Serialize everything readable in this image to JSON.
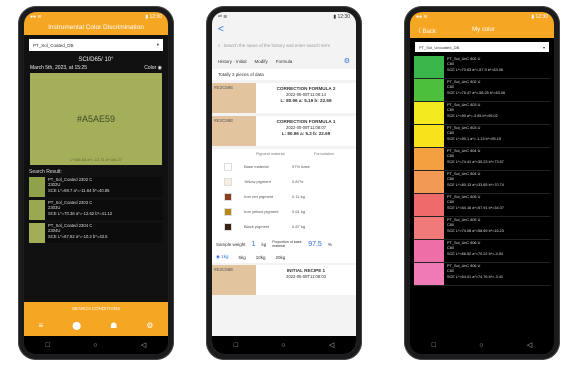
{
  "phone1": {
    "status_left": "●● ≋",
    "status_right": "▮ 12:30",
    "title": "Instrumental Color Discrimination",
    "select_value": "PT_Sol_Coated_DB",
    "condition": "SCI/D65/ 10°",
    "date": "March 5th, 2023, at 15:25",
    "color_label": "Color",
    "hex": "#A5AE59",
    "swatch_sub": "L*=68.53 a*=-12.71 b*=44.27",
    "search_label": "Search Result:",
    "results": [
      {
        "color": "#8fa24a",
        "line1": "PT_Sol_Coated 2302 C",
        "line2": "2302U",
        "line3": "SCE L*=69.7 a*=-11.64 b*=40.85"
      },
      {
        "color": "#9aa84f",
        "line1": "PT_Sol_Coated 2303 C",
        "line2": "2303U",
        "line3": "SCE L*=70.36 a*=-12.62 b*=41.12"
      },
      {
        "color": "#a3ad55",
        "line1": "PT_Sol_Coated 2304 C",
        "line2": "2304U",
        "line3": "SCE L*=67.82 a*=-10.2 b*=43.5"
      }
    ],
    "button": "SEARCH CONDITIONS",
    "tabs": [
      "≡",
      "⬤",
      "☗",
      "⚙"
    ],
    "nav": [
      "□",
      "○",
      "◁"
    ]
  },
  "phone2": {
    "status_left": "ᵃᵗˡ ≋",
    "status_right": "▮ 12:30",
    "back": "<",
    "search_placeholder": "Search the name of the history and enter search term",
    "history_tabs": [
      "History · Initial",
      "Modify",
      "Formula"
    ],
    "count": "Totally 3 pieces of data",
    "cards": [
      {
        "color": "#e2c59e",
        "hex": "#E2C59E",
        "title": "CORRECTION FORMULA 2",
        "date": "2022-05-08T11:08:14",
        "lab": "L: 80.96 a: 5.19 b: 22.69"
      },
      {
        "color": "#e2c59e",
        "hex": "#E2C59E",
        "title": "CORRECTION FORMULA 1",
        "date": "2022-05-08T11:08:07",
        "lab": "L: 80.96 a: 5.2 b: 22.69"
      }
    ],
    "recipe_head": [
      "Pigment material",
      "Formulation"
    ],
    "recipe": [
      {
        "color": "#ffffff",
        "name": "Base material",
        "val": "97% base"
      },
      {
        "color": "#f7eedd",
        "name": "Yellow pigment",
        "val": "0.87%"
      },
      {
        "color": "#8a3f22",
        "name": "Iron red pigment",
        "val": "0.11 kg"
      },
      {
        "color": "#b58a1a",
        "name": "Iron yellow pigment",
        "val": "0.61 kg"
      },
      {
        "color": "#3a2418",
        "name": "Black pigment",
        "val": "0.87 kg"
      }
    ],
    "sample_label": "Sample weight",
    "sample_val": "1",
    "sample_unit": "kg",
    "prop_label": "Proportion of base material",
    "prop_val": "97.5",
    "prop_unit": "%",
    "radios": [
      "1kg",
      "5kg",
      "10kg",
      "20kg"
    ],
    "last_card": {
      "color": "#e2c59e",
      "hex": "#E2C59E",
      "title": "INITIAL RECIPE 1",
      "date": "2022-05-08T11:08:03"
    },
    "nav": [
      "□",
      "○",
      "◁"
    ]
  },
  "phone3": {
    "status_left": "●● ≋",
    "status_right": "▮ 12:30",
    "back": "〈 Back",
    "title": "My color",
    "select_value": "PT_Sol_Uncoated_DB",
    "rows": [
      {
        "color": "#3ab54a",
        "l1": "PT_Sol_UnC 802 U",
        "l2": "C80",
        "l3": "SCE L*=70.63 a*=-57.9 b*=63.06"
      },
      {
        "color": "#4cbf3c",
        "l1": "PT_Sol_UnC 802 U",
        "l2": "C80",
        "l3": "SCE L*=75.47 a*=-58.25 b*=63.06"
      },
      {
        "color": "#f2ea1c",
        "l1": "PT_Sol_UnC 803 U",
        "l2": "C80",
        "l3": "SCE L*=90 a*=-3.95 b*=95.02"
      },
      {
        "color": "#f7e21c",
        "l1": "PT_Sol_UnC 803 U",
        "l2": "C80",
        "l3": "SCE L*=90.1 a*=-1.13 b*=95.15"
      },
      {
        "color": "#f3a040",
        "l1": "PT_Sol_UnC 804 U",
        "l2": "C80",
        "l3": "SCE L*=74.41 a*=35.23 b*=73.57"
      },
      {
        "color": "#f29a55",
        "l1": "PT_Sol_UnC 804 U",
        "l2": "C80",
        "l3": "SCE L*=80.13 a*=33.65 b*=70.74"
      },
      {
        "color": "#ef6a6a",
        "l1": "PT_Sol_UnC 805 U",
        "l2": "C80",
        "l3": "SCE L*=64.16 a*=57.91 b*=34.07"
      },
      {
        "color": "#f07a7a",
        "l1": "PT_Sol_UnC 805 U",
        "l2": "C80",
        "l3": "SCE L*=74.08 a*=58.69 b*=16.23"
      },
      {
        "color": "#ee6fa8",
        "l1": "PT_Sol_UnC 806 U",
        "l2": "C80",
        "l3": "SCE L*=66.52 a*=70.22 b*=-4.54"
      },
      {
        "color": "#f07ab5",
        "l1": "PT_Sol_UnC 806 U",
        "l2": "C80",
        "l3": "SCE L*=64.01 a*=74.76 b*=-3.41"
      }
    ],
    "nav": [
      "□",
      "○",
      "◁"
    ]
  }
}
